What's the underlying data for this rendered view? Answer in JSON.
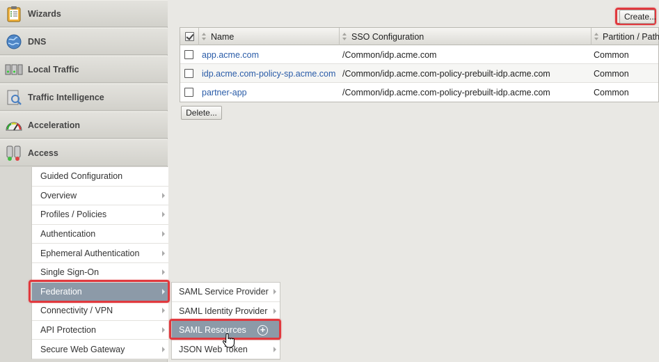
{
  "nav": {
    "items": [
      {
        "label": "Wizards",
        "icon": "clipboard-icon"
      },
      {
        "label": "DNS",
        "icon": "globe-icon"
      },
      {
        "label": "Local Traffic",
        "icon": "server-icon"
      },
      {
        "label": "Traffic Intelligence",
        "icon": "analytics-icon"
      },
      {
        "label": "Acceleration",
        "icon": "speedometer-icon"
      },
      {
        "label": "Access",
        "icon": "access-icon"
      }
    ]
  },
  "access_menu": {
    "items": [
      {
        "label": "Guided Configuration",
        "has_arrow": false
      },
      {
        "label": "Overview",
        "has_arrow": true
      },
      {
        "label": "Profiles / Policies",
        "has_arrow": true
      },
      {
        "label": "Authentication",
        "has_arrow": true
      },
      {
        "label": "Ephemeral Authentication",
        "has_arrow": true
      },
      {
        "label": "Single Sign-On",
        "has_arrow": true
      },
      {
        "label": "Federation",
        "has_arrow": true,
        "active": true
      },
      {
        "label": "Connectivity / VPN",
        "has_arrow": true
      },
      {
        "label": "API Protection",
        "has_arrow": true
      },
      {
        "label": "Secure Web Gateway",
        "has_arrow": true
      }
    ]
  },
  "federation_menu": {
    "items": [
      {
        "label": "SAML Service Provider",
        "has_arrow": true
      },
      {
        "label": "SAML Identity Provider",
        "has_arrow": true
      },
      {
        "label": "SAML Resources",
        "active": true,
        "plus": "+"
      },
      {
        "label": "JSON Web Token",
        "has_arrow": true
      }
    ]
  },
  "toolbar": {
    "create_label": "Create...",
    "delete_label": "Delete..."
  },
  "table": {
    "columns": [
      "Name",
      "SSO Configuration",
      "Partition / Path"
    ],
    "rows": [
      {
        "name": "app.acme.com",
        "sso": "/Common/idp.acme.com",
        "partition": "Common"
      },
      {
        "name": "idp.acme.com-policy-sp.acme.com",
        "sso": "/Common/idp.acme.com-policy-prebuilt-idp.acme.com",
        "partition": "Common"
      },
      {
        "name": "partner-app",
        "sso": "/Common/idp.acme.com-policy-prebuilt-idp.acme.com",
        "partition": "Common"
      }
    ]
  },
  "colors": {
    "highlight": "#e0393e",
    "active_menu": "#8c9aa8",
    "link": "#2a5ca8"
  }
}
